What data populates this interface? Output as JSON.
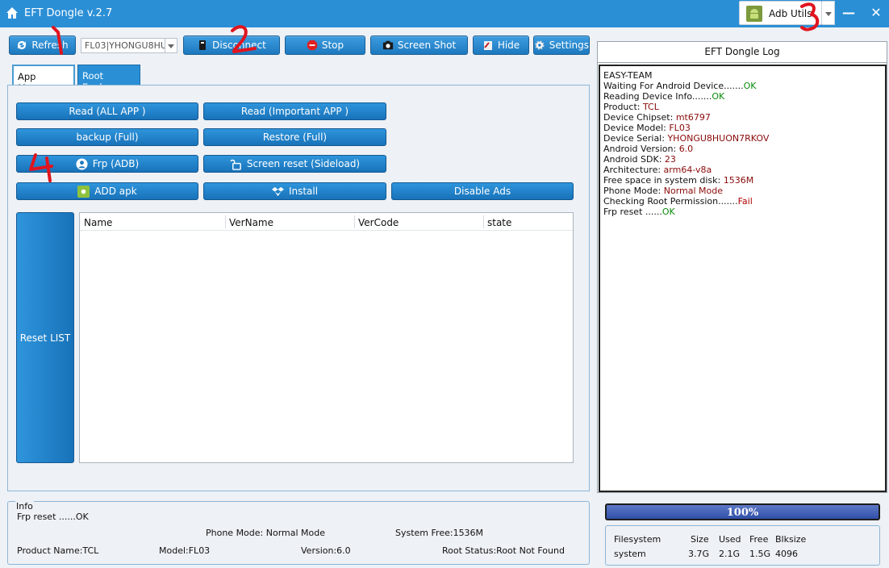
{
  "window": {
    "title": "EFT Dongle  v.2.7"
  },
  "adb_utils": {
    "label": "Adb Utils"
  },
  "toolbar": {
    "refresh": "Refresh",
    "device_value": "FL03|YHONGU8HU",
    "disconnect": "Disconnect",
    "stop": "Stop",
    "screenshot": "Screen Shot",
    "hide": "Hide",
    "settings": "Settings"
  },
  "tabs": {
    "app_manager": "App Manager",
    "root_explorer": "Root Explorer"
  },
  "actions": {
    "read_all": "Read (ALL APP )",
    "read_important": "Read (Important APP )",
    "backup": "backup (Full)",
    "restore": "Restore (Full)",
    "frp": "Frp (ADB)",
    "screen_reset": "Screen reset  (Sideload)",
    "add_apk": "ADD apk",
    "install": "Install",
    "disable_ads": "Disable Ads",
    "reset_list": "Reset LIST"
  },
  "app_list": {
    "columns": [
      "Name",
      "VerName",
      "VerCode",
      "state"
    ]
  },
  "log": {
    "title": "EFT Dongle Log",
    "lines": [
      {
        "text": "EASY-TEAM",
        "suffix": "",
        "kind": ""
      },
      {
        "text": "Waiting For Android Device.......",
        "suffix": "OK",
        "kind": "ok"
      },
      {
        "text": "Reading Device Info.......",
        "suffix": "OK",
        "kind": "ok"
      },
      {
        "text": "Product: ",
        "suffix": "TCL",
        "kind": "val"
      },
      {
        "text": "Device Chipset: ",
        "suffix": "mt6797",
        "kind": "val"
      },
      {
        "text": "Device Model: ",
        "suffix": "FL03",
        "kind": "val"
      },
      {
        "text": "Device Serial: ",
        "suffix": "YHONGU8HUON7RKOV",
        "kind": "val"
      },
      {
        "text": "Android Version: ",
        "suffix": "6.0",
        "kind": "val"
      },
      {
        "text": "Android SDK: ",
        "suffix": "23",
        "kind": "val"
      },
      {
        "text": "Architecture: ",
        "suffix": "arm64-v8a",
        "kind": "val"
      },
      {
        "text": "Free space in system disk: ",
        "suffix": "1536M",
        "kind": "val"
      },
      {
        "text": "Phone Mode: ",
        "suffix": "Normal Mode",
        "kind": "val"
      },
      {
        "text": "Checking Root Permission.......",
        "suffix": "Fail",
        "kind": "fail"
      },
      {
        "text": "Frp reset ......",
        "suffix": "OK",
        "kind": "ok"
      }
    ]
  },
  "info": {
    "title": "Info",
    "status": "Frp reset ......OK",
    "phone_mode": "Phone Mode: Normal Mode",
    "system_free": "System Free:1536M",
    "product_name": "Product Name:TCL",
    "model": "Model:FL03",
    "version": "Version:6.0",
    "root_status": "Root Status:Root Not Found"
  },
  "progress": {
    "text": "100%",
    "value": 100
  },
  "filesystem": {
    "headers": [
      "Filesystem",
      "Size",
      "Used",
      "Free",
      "Blksize"
    ],
    "row": [
      "system",
      "3.7G",
      "2.1G",
      "1.5G",
      "4096"
    ]
  },
  "annotations": [
    "1",
    "2",
    "3",
    "4"
  ],
  "colors": {
    "accent": "#2b8fd6",
    "ok": "#0a8a0a",
    "value": "#8a0a0a",
    "annotation": "#e0141e"
  }
}
